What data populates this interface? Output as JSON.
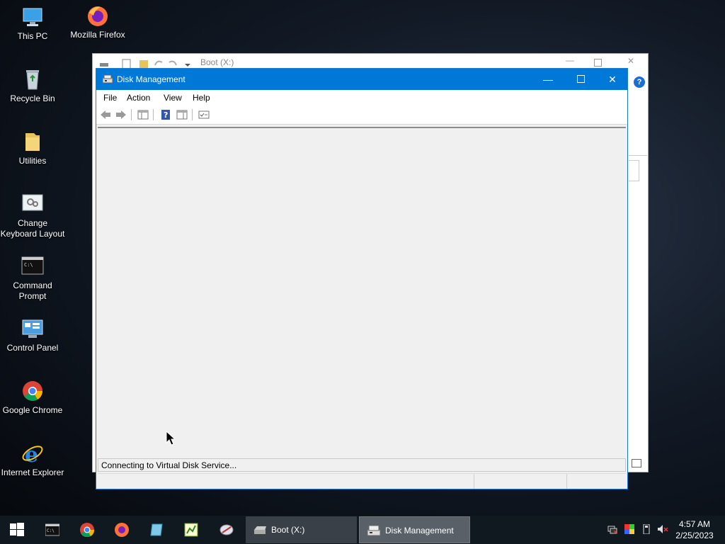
{
  "desktop": {
    "icons": [
      {
        "label": "This PC"
      },
      {
        "label": "Mozilla Firefox"
      },
      {
        "label": "Recycle Bin"
      },
      {
        "label": "Utilities"
      },
      {
        "label": "Change Keyboard Layout"
      },
      {
        "label": "Command Prompt"
      },
      {
        "label": "Control Panel"
      },
      {
        "label": "Google Chrome"
      },
      {
        "label": "Internet Explorer"
      }
    ]
  },
  "back_window": {
    "title": "Boot (X:)"
  },
  "disk_mgmt": {
    "title": "Disk Management",
    "menu": [
      "File",
      "Action",
      "View",
      "Help"
    ],
    "status": "Connecting to Virtual Disk Service..."
  },
  "taskbar": {
    "tasks": [
      {
        "label": "Boot (X:)"
      },
      {
        "label": "Disk Management"
      }
    ],
    "time": "4:57 AM",
    "date": "2/25/2023"
  },
  "colors": {
    "title_bar": "#0078d7",
    "taskbar": "#101820"
  }
}
